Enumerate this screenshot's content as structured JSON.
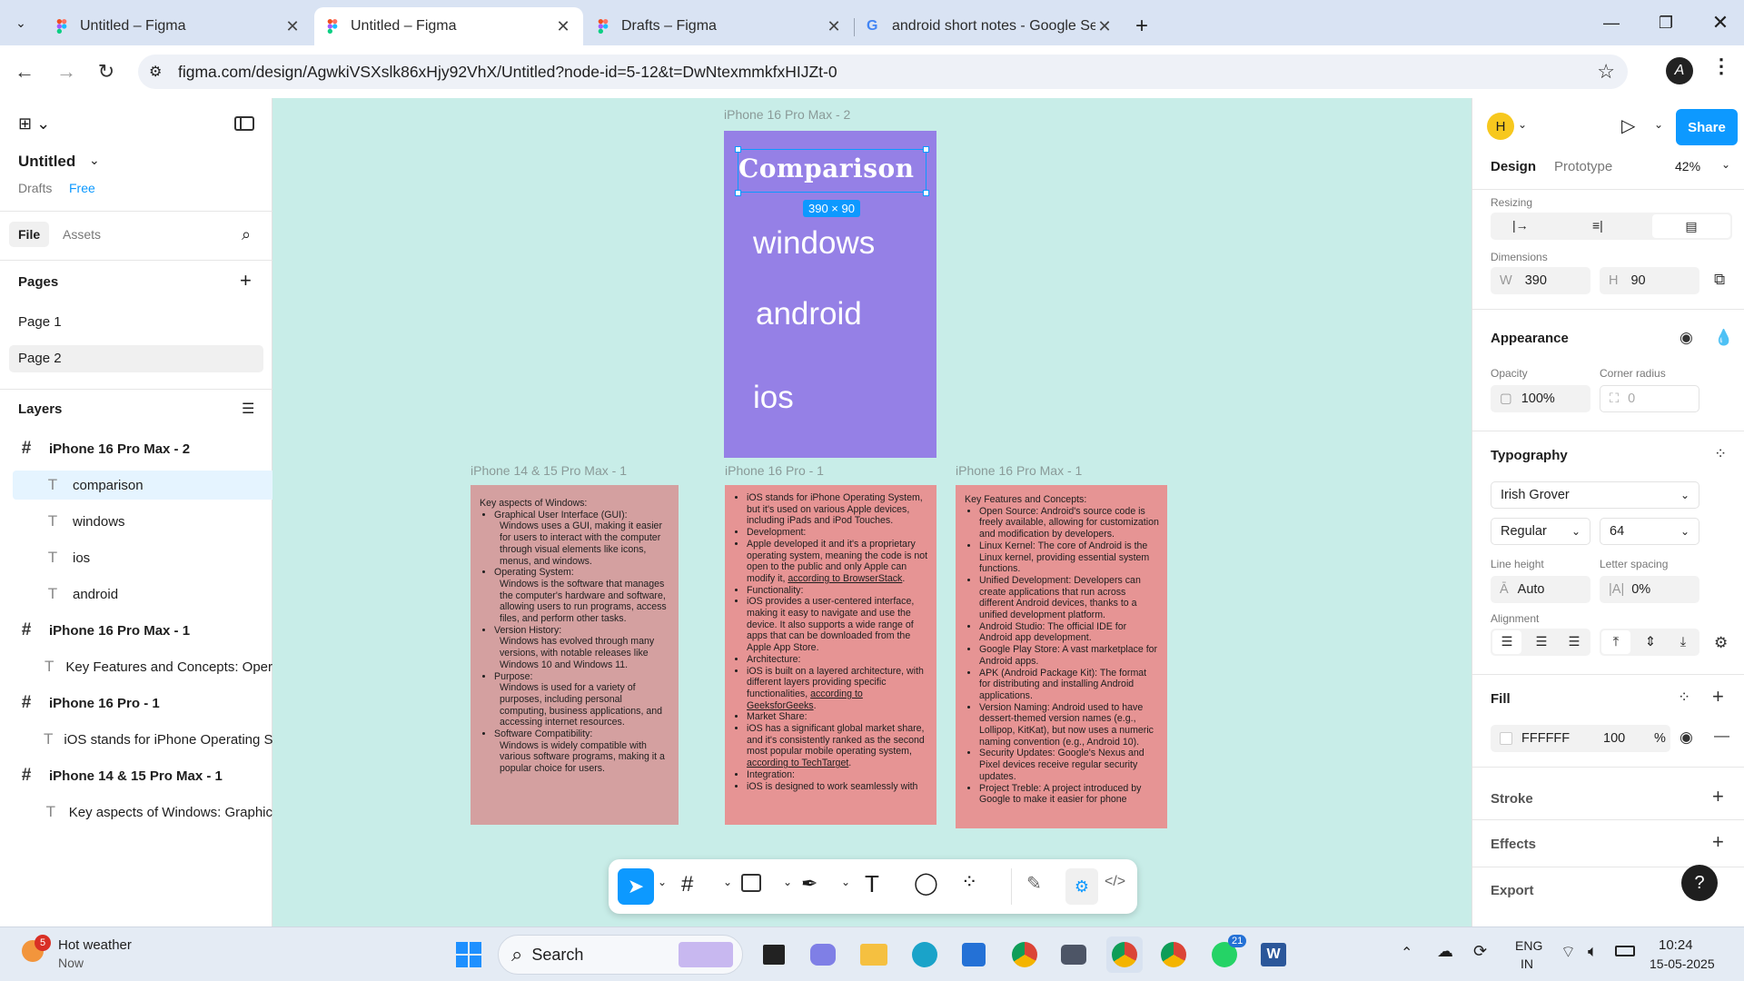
{
  "browser": {
    "tabs": [
      {
        "title": "Untitled – Figma",
        "icon": "figma-icon"
      },
      {
        "title": "Untitled – Figma",
        "icon": "figma-icon"
      },
      {
        "title": "Drafts – Figma",
        "icon": "figma-icon"
      },
      {
        "title": "android short notes - Google Se",
        "icon": "google-icon"
      }
    ],
    "url": "figma.com/design/AgwkiVSXslk86xHjy92VhX/Untitled?node-id=5-12&t=DwNtexmmkfxHIJZt-0",
    "profile_initial": "A"
  },
  "left_panel": {
    "file_name": "Untitled",
    "drafts": "Drafts",
    "plan": "Free",
    "tabs": {
      "file": "File",
      "assets": "Assets"
    },
    "pages_title": "Pages",
    "pages": [
      "Page 1",
      "Page 2"
    ],
    "layers_title": "Layers",
    "layers": [
      {
        "name": "iPhone 16 Pro Max - 2",
        "type": "frame"
      },
      {
        "name": "comparison",
        "type": "text"
      },
      {
        "name": "windows",
        "type": "text"
      },
      {
        "name": "ios",
        "type": "text"
      },
      {
        "name": "android",
        "type": "text"
      },
      {
        "name": "iPhone 16 Pro Max - 1",
        "type": "frame"
      },
      {
        "name": "Key Features and Concepts: Oper",
        "type": "text"
      },
      {
        "name": "iPhone 16 Pro - 1",
        "type": "frame"
      },
      {
        "name": "iOS stands for iPhone Operating S",
        "type": "text"
      },
      {
        "name": "iPhone 14 & 15 Pro Max - 1",
        "type": "frame"
      },
      {
        "name": "Key aspects of Windows: Graphic",
        "type": "text"
      }
    ]
  },
  "canvas": {
    "bg": "#c8ede8",
    "main_frame": {
      "label": "iPhone 16 Pro Max - 2",
      "title": "Comparison",
      "size_badge": "390 × 90",
      "items": [
        "windows",
        "android",
        "ios"
      ],
      "color": "#9580e6"
    },
    "frames": [
      {
        "label": "iPhone 14 & 15 Pro Max - 1",
        "color": "#d4a0a0",
        "intro": "Key aspects of Windows:",
        "items": [
          {
            "t": "Graphical User Interface (GUI):"
          },
          {
            "t": "Windows uses a GUI, making it easier for users to interact with the computer through visual elements like icons, menus, and windows.",
            "sub": true
          },
          {
            "t": "Operating System:"
          },
          {
            "t": "Windows is the software that manages the computer's hardware and software, allowing users to run programs, access files, and perform other tasks.",
            "sub": true
          },
          {
            "t": "Version History:"
          },
          {
            "t": "Windows has evolved through many versions, with notable releases like Windows 10 and Windows 11.",
            "sub": true
          },
          {
            "t": "Purpose:"
          },
          {
            "t": "Windows is used for a variety of purposes, including personal computing, business applications, and accessing internet resources.",
            "sub": true
          },
          {
            "t": "Software Compatibility:"
          },
          {
            "t": "Windows is widely compatible with various software programs, making it a popular choice for users.",
            "sub": true
          }
        ]
      },
      {
        "label": "iPhone 16 Pro - 1",
        "color": "#e69494",
        "items": [
          {
            "t": "iOS stands for iPhone Operating System, but it's used on various Apple devices, including iPads and iPod Touches."
          },
          {
            "t": "Development:"
          },
          {
            "t": "Apple developed it and it's a proprietary operating system, meaning the code is not open to the public and only Apple can modify it,",
            "link": "according to BrowserStack",
            "end": "."
          },
          {
            "t": "Functionality:"
          },
          {
            "t": "iOS provides a user-centered interface, making it easy to navigate and use the device. It also supports a wide range of apps that can be downloaded from the Apple App Store."
          },
          {
            "t": "Architecture:"
          },
          {
            "t": "iOS is built on a layered architecture, with different layers providing specific functionalities,",
            "link": "according to GeeksforGeeks",
            "end": "."
          },
          {
            "t": "Market Share:"
          },
          {
            "t": "iOS has a significant global market share, and it's consistently ranked as the second most popular mobile operating system,",
            "link": "according to TechTarget",
            "end": "."
          },
          {
            "t": "Integration:"
          },
          {
            "t": "iOS is designed to work seamlessly with"
          }
        ]
      },
      {
        "label": "iPhone 16 Pro Max - 1",
        "color": "#e69494",
        "intro": "Key Features and Concepts:",
        "items": [
          {
            "t": "Open Source: Android's source code is freely available, allowing for customization and modification by developers."
          },
          {
            "t": "Linux Kernel: The core of Android is the Linux kernel, providing essential system functions."
          },
          {
            "t": "Unified Development: Developers can create applications that run across different Android devices, thanks to a unified development platform."
          },
          {
            "t": "Android Studio: The official IDE for Android app development."
          },
          {
            "t": "Google Play Store: A vast marketplace for Android apps."
          },
          {
            "t": "APK (Android Package Kit): The format for distributing and installing Android applications."
          },
          {
            "t": "Version Naming: Android used to have dessert-themed version names (e.g., Lollipop, KitKat), but now uses a numeric naming convention (e.g., Android 10)."
          },
          {
            "t": "Security Updates: Google's Nexus and Pixel devices receive regular security updates."
          },
          {
            "t": "Project Treble: A project introduced by Google to make it easier for phone"
          }
        ]
      }
    ]
  },
  "right_panel": {
    "user_initial": "H",
    "share": "Share",
    "tabs": {
      "design": "Design",
      "prototype": "Prototype"
    },
    "zoom": "42%",
    "resizing": "Resizing",
    "dimensions": "Dimensions",
    "w_label": "W",
    "w": "390",
    "h_label": "H",
    "h": "90",
    "appearance": "Appearance",
    "opacity_label": "Opacity",
    "opacity": "100%",
    "radius_label": "Corner radius",
    "radius": "0",
    "typography": "Typography",
    "font": "Irish Grover",
    "weight": "Regular",
    "size": "64",
    "lh_label": "Line height",
    "lh": "Auto",
    "ls_label": "Letter spacing",
    "ls": "0%",
    "align_label": "Alignment",
    "fill": "Fill",
    "fill_hex": "FFFFFF",
    "fill_opacity": "100",
    "fill_pct": "%",
    "stroke": "Stroke",
    "effects": "Effects",
    "export": "Export"
  },
  "toolbar": {
    "tools": [
      "move-tool",
      "frame-tool",
      "image-tool",
      "pen-tool",
      "text-tool",
      "comment-tool",
      "components-tool",
      "draw-mode",
      "design-mode",
      "dev-mode"
    ]
  },
  "taskbar": {
    "weather_title": "Hot weather",
    "weather_sub": "Now",
    "weather_badge": "5",
    "search": "Search",
    "whatsapp_badge": "21",
    "lang1": "ENG",
    "lang2": "IN",
    "time": "10:24",
    "date": "15-05-2025"
  }
}
